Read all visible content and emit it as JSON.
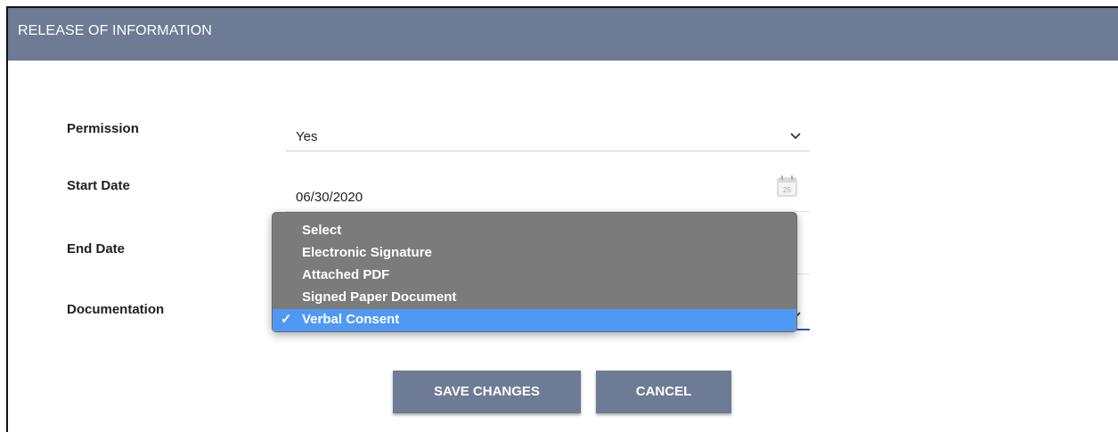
{
  "header": {
    "title": "RELEASE OF INFORMATION"
  },
  "form": {
    "permission": {
      "label": "Permission",
      "value": "Yes"
    },
    "start_date": {
      "label": "Start Date",
      "value": "06/30/2020",
      "calendar_day": "25"
    },
    "end_date": {
      "label": "End Date",
      "value": ""
    },
    "documentation": {
      "label": "Documentation"
    }
  },
  "dropdown": {
    "options": [
      {
        "label": "Select",
        "selected": false
      },
      {
        "label": "Electronic Signature",
        "selected": false
      },
      {
        "label": "Attached PDF",
        "selected": false
      },
      {
        "label": "Signed Paper Document",
        "selected": false
      },
      {
        "label": "Verbal Consent",
        "selected": true
      }
    ],
    "check_mark": "✓"
  },
  "buttons": {
    "save_label": "SAVE CHANGES",
    "cancel_label": "CANCEL"
  },
  "colors": {
    "header": "#6d7c94",
    "button": "#6d7c94",
    "dropdown_bg": "#7b7b7b",
    "selection": "#4f99f5",
    "focus_underline": "#2f55c9"
  },
  "icons": {
    "chevron": "chevron-down-icon",
    "calendar": "calendar-icon"
  }
}
